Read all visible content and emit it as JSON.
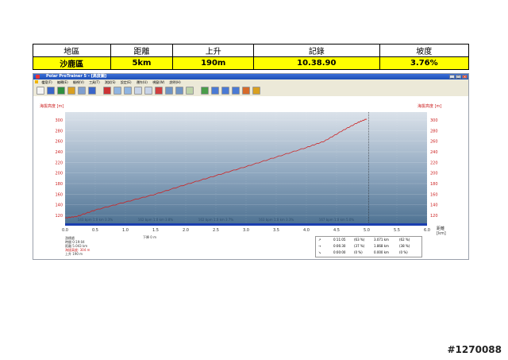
{
  "stats_table": {
    "headers": [
      "地區",
      "距離",
      "上升",
      "記錄",
      "坡度"
    ],
    "values": [
      "沙鹿區",
      "5km",
      "190m",
      "10.38.90",
      "3.76%"
    ]
  },
  "app": {
    "title": "Polar ProTrainer 5 - [高度圖]",
    "menu": [
      "檔案(F)",
      "編輯(E)",
      "檢視(V)",
      "工具(T)",
      "測試(S)",
      "設定(E)",
      "運作(U)",
      "視窗(W)",
      "說明(H)"
    ],
    "toolbar_icons": [
      "new-icon",
      "save-icon",
      "globe-icon",
      "pie-icon",
      "grid-icon",
      "disk-icon",
      "flag-icon",
      "bar-icon",
      "bar-icon",
      "table-icon",
      "table-icon",
      "pin-icon",
      "upload-icon",
      "download-icon",
      "list-icon",
      "chart-icon",
      "chart-icon",
      "chart-icon",
      "chart-icon",
      "chart-icon",
      "link-icon"
    ]
  },
  "chart_data": {
    "type": "area",
    "ylabel_left": "海拔高度 [m]",
    "ylabel_right": "海拔高度 [m]",
    "xlabel": "距離",
    "xunit": "[km]",
    "xlim": [
      0,
      6
    ],
    "ylim": [
      105,
      315
    ],
    "yticks": [
      120,
      140,
      160,
      180,
      200,
      220,
      240,
      260,
      280,
      300
    ],
    "xticks": [
      "0.0",
      "0.5",
      "1.0",
      "1.5",
      "2.0",
      "2.5",
      "3.0",
      "3.5",
      "4.0",
      "4.5",
      "5.0",
      "5.5",
      "6.0"
    ],
    "x": [
      0.0,
      0.2,
      0.5,
      1.0,
      1.5,
      2.0,
      2.5,
      3.0,
      3.5,
      4.0,
      4.3,
      4.6,
      4.85,
      5.0
    ],
    "y": [
      115,
      118,
      130,
      145,
      160,
      178,
      195,
      212,
      230,
      248,
      260,
      280,
      295,
      302
    ],
    "cursor_x": 5.03,
    "lap_labels": [
      "143 bpm 1.0 km 3.3%",
      "162 bpm 1.0 km 3.8%",
      "162 bpm 1.0 km 3.7%",
      "163 bpm 1.0 km 3.3%",
      "167 bpm 1.0 km 5.0%"
    ]
  },
  "bottom_left": {
    "lines": [
      "游標處",
      "時間  0:19:04",
      "距離  5.043 km",
      "海拔高度: 304 m",
      "上升   190 m"
    ],
    "down_label": "下降  0 m"
  },
  "summary_box": {
    "rows": [
      {
        "icon": "↗",
        "time": "0:11:05",
        "pct_time": "(63 %)",
        "dist": "3.071 km",
        "pct_dist": "(62 %)"
      },
      {
        "icon": "→",
        "time": "0:06:30",
        "pct_time": "(37 %)",
        "dist": "1.868 km",
        "pct_dist": "(38 %)"
      },
      {
        "icon": "↘",
        "time": "0:00:00",
        "pct_time": "(0 %)",
        "dist": "0.000 km",
        "pct_dist": "(0 %)"
      }
    ]
  },
  "watermark": "#1270088",
  "colors": {
    "highlight": "#ffff00",
    "profile_line": "#cc2222",
    "axis_text": "#cc2222",
    "plot_top": "#dbe2ea",
    "plot_bottom": "#4f7393",
    "cursor_bar": "#1a3fb0"
  }
}
